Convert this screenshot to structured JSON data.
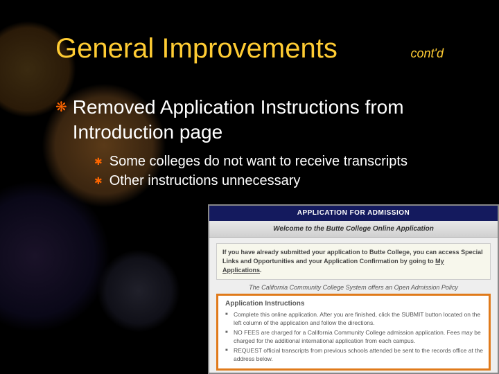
{
  "slide": {
    "title": "General Improvements",
    "contd": "cont'd",
    "bullet_main": "Removed Application Instructions from Introduction page",
    "sub_bullets": [
      "Some colleges do not want to receive transcripts",
      "Other instructions unnecessary"
    ]
  },
  "screenshot": {
    "app_title": "APPLICATION FOR ADMISSION",
    "welcome": "Welcome to the Butte College Online Application",
    "special_prefix": "If you have already submitted your application to Butte College, you can access Special Links and Opportunities and your Application Confirmation by going to ",
    "special_link": "My Applications",
    "policy": "The California Community College System offers an Open Admission Policy",
    "instructions_title": "Application Instructions",
    "instructions": [
      "Complete this online application. After you are finished, click the SUBMIT button located on the left column of the application and follow the directions.",
      "NO FEES are charged for a California Community College admission application. Fees may be charged for the additional international application from each campus.",
      "REQUEST official transcripts from previous schools attended be sent to the records office at the address below."
    ]
  }
}
